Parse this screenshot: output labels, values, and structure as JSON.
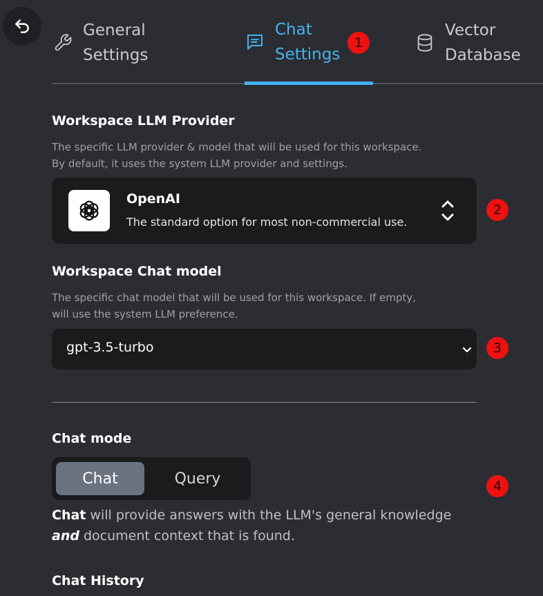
{
  "tabs": [
    {
      "label_line1": "General",
      "label_line2": "Settings",
      "icon": "wrench-icon",
      "active": false
    },
    {
      "label_line1": "Chat",
      "label_line2": "Settings",
      "icon": "chat-icon",
      "active": true
    },
    {
      "label_line1": "Vector",
      "label_line2": "Database",
      "icon": "database-icon",
      "active": false
    }
  ],
  "badges": [
    "1",
    "2",
    "3",
    "4"
  ],
  "llm_provider": {
    "title": "Workspace LLM Provider",
    "description_line1": "The specific LLM provider & model that will be used for this workspace.",
    "description_line2": "By default, it uses the system LLM provider and settings.",
    "selected_name": "OpenAI",
    "selected_description": "The standard option for most non-commercial use.",
    "logo_icon": "openai-logo-icon"
  },
  "chat_model": {
    "title": "Workspace Chat model",
    "description_line1": "The specific chat model that will be used for this workspace. If empty,",
    "description_line2": "will use the system LLM preference.",
    "value": "gpt-3.5-turbo"
  },
  "chat_mode": {
    "title": "Chat mode",
    "options": [
      "Chat",
      "Query"
    ],
    "selected": "Chat",
    "desc_strong": "Chat",
    "desc_part1": " will provide answers with the LLM's general knowledge",
    "desc_emph": "and",
    "desc_part2": " document context that is found."
  },
  "chat_history": {
    "title": "Chat History"
  },
  "colors": {
    "accent": "#46b1ee",
    "background": "#2c2d32",
    "panel": "#1b1b1e",
    "badge": "#ee1111"
  }
}
